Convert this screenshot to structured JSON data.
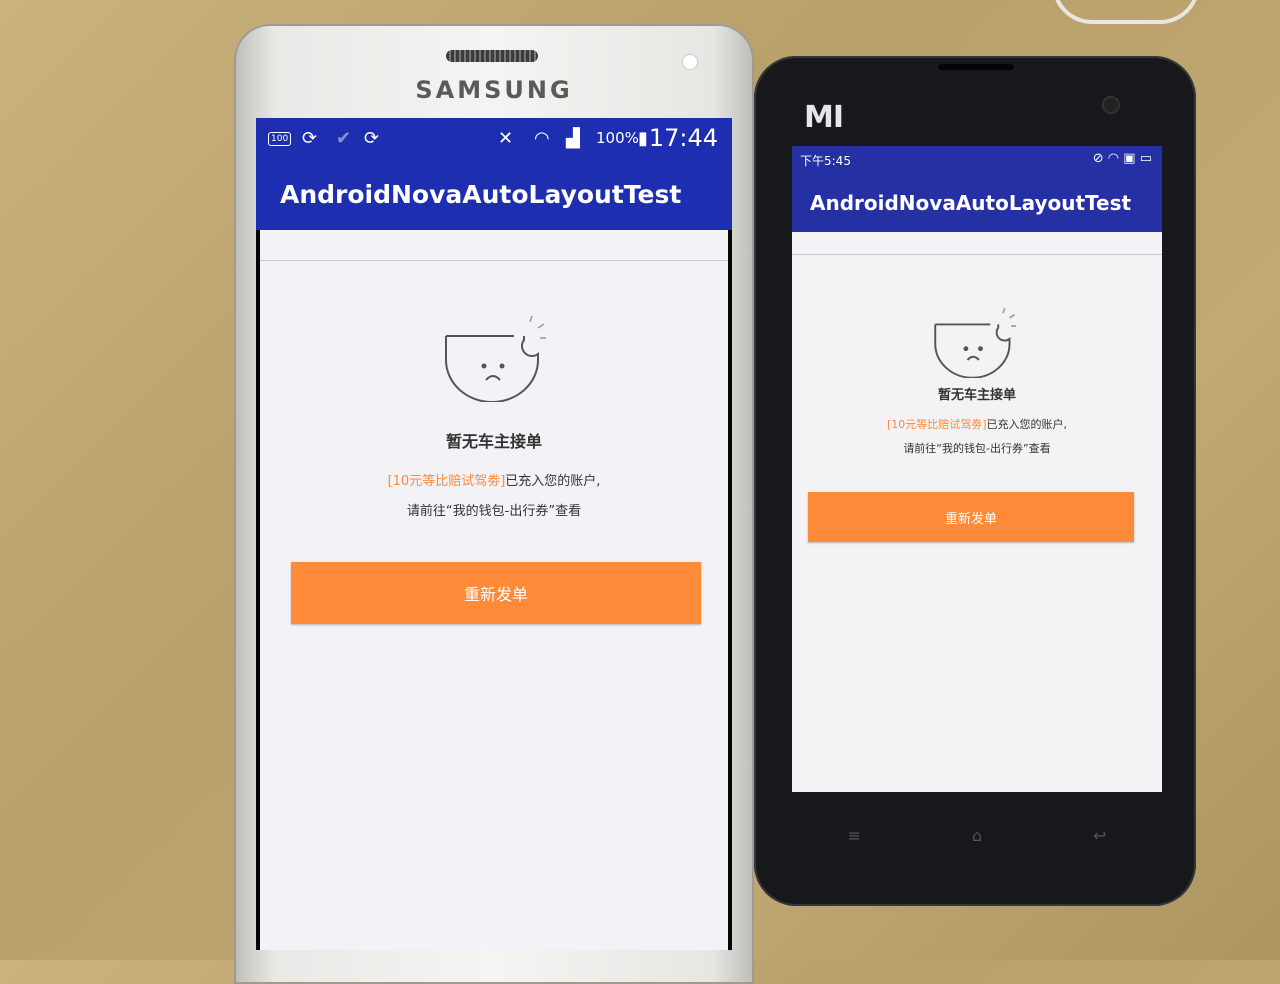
{
  "samsung": {
    "brand": "SAMSUNG",
    "status": {
      "battery_badge": "100",
      "battery_pct": "100%",
      "time": "17:44"
    },
    "app_title": "AndroidNovaAutoLayoutTest",
    "empty_title": "暂无车主接单",
    "coupon_highlight": "[10元等比赔试驾劵]",
    "coupon_rest": "已充入您的账户,",
    "wallet_hint": "请前往“我的钱包-出行券”查看",
    "button_label": "重新发单"
  },
  "xiaomi": {
    "brand": "MI",
    "status": {
      "time": "下午5:45"
    },
    "app_title": "AndroidNovaAutoLayoutTest",
    "empty_title": "暂无车主接单",
    "coupon_highlight": "[10元等比赔试驾劵]",
    "coupon_rest": "已充入您的账户,",
    "wallet_hint": "请前往“我的钱包-出行券”查看",
    "button_label": "重新发单"
  },
  "colors": {
    "app_bar": "#1d2fb0",
    "accent": "#ff8a3a",
    "background": "#f3f2f6"
  }
}
